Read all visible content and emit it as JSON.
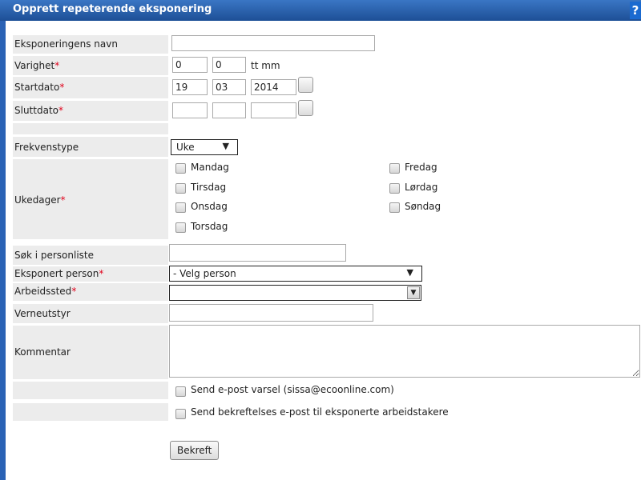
{
  "dialog": {
    "title": "Opprett repeterende eksponering",
    "help_label": "?"
  },
  "fields": {
    "name_label": "Eksponeringens navn",
    "name_value": "",
    "duration_label": "Varighet",
    "duration_hours": "0",
    "duration_minutes": "0",
    "duration_unit": "tt mm",
    "start_label": "Startdato",
    "start_day": "19",
    "start_month": "03",
    "start_year": "2014",
    "end_label": "Sluttdato",
    "end_day": "",
    "end_month": "",
    "end_year": "",
    "frequency_label": "Frekvenstype",
    "frequency_value": "Uke",
    "weekdays_label": "Ukedager",
    "weekdays": [
      "Mandag",
      "Tirsdag",
      "Onsdag",
      "Torsdag",
      "Fredag",
      "Lørdag",
      "Søndag"
    ],
    "search_label": "Søk i personliste",
    "search_value": "",
    "person_label": "Eksponert person",
    "person_value": "- Velg person",
    "workplace_label": "Arbeidssted",
    "workplace_value": "",
    "ppe_label": "Verneutstyr",
    "ppe_value": "",
    "comment_label": "Kommentar",
    "comment_value": "",
    "email_notice_label": "Send e-post varsel (sissa@ecoonline.com)",
    "confirm_email_label": "Send bekreftelses e-post til eksponerte arbeidstakere"
  },
  "required_marker": "*",
  "actions": {
    "submit_label": "Bekreft"
  }
}
